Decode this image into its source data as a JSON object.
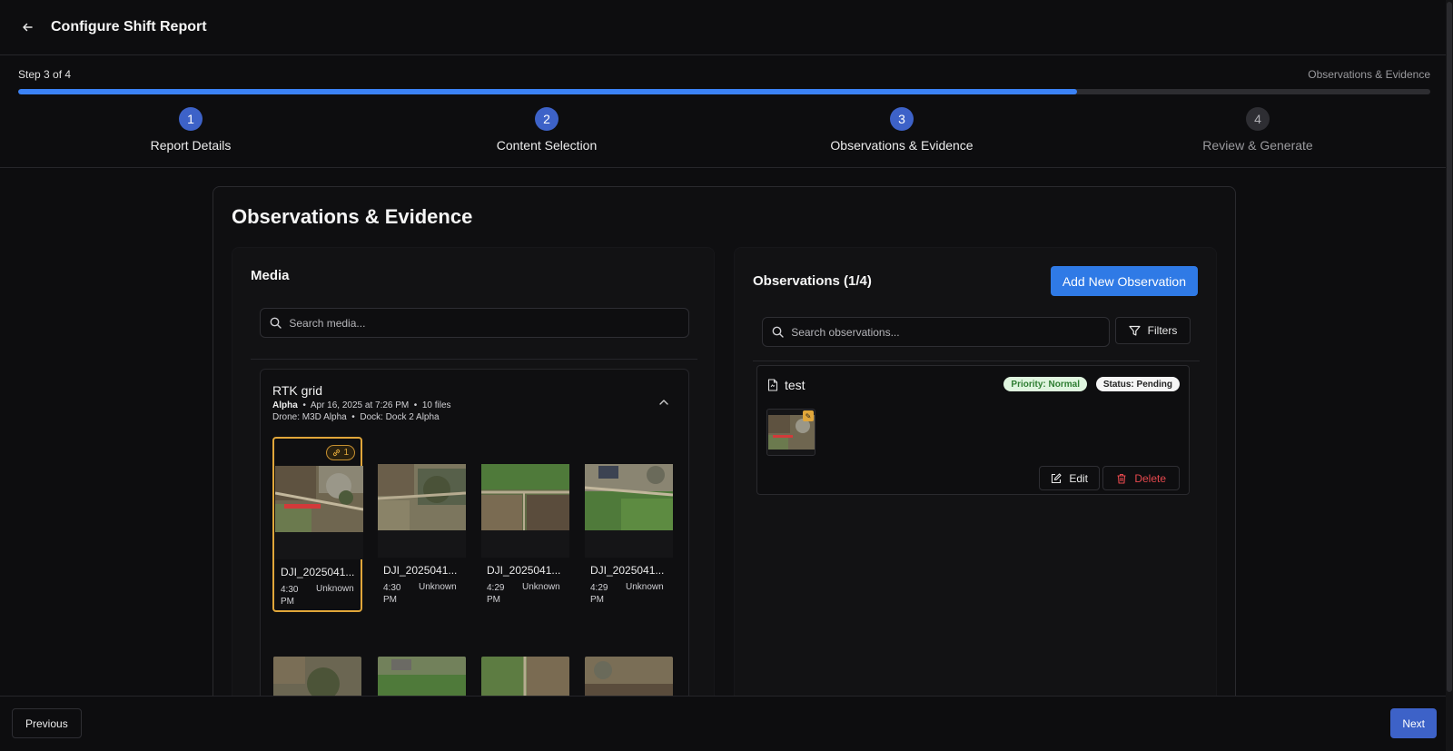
{
  "header": {
    "title": "Configure Shift Report"
  },
  "progress": {
    "step_count": "Step 3 of 4",
    "current_step_name": "Observations & Evidence",
    "fraction": 0.75
  },
  "steps": [
    {
      "number": "1",
      "label": "Report Details",
      "state": "complete"
    },
    {
      "number": "2",
      "label": "Content Selection",
      "state": "complete"
    },
    {
      "number": "3",
      "label": "Observations & Evidence",
      "state": "current"
    },
    {
      "number": "4",
      "label": "Review & Generate",
      "state": "pending"
    }
  ],
  "section": {
    "title": "Observations & Evidence"
  },
  "media": {
    "title": "Media",
    "search_placeholder": "Search media...",
    "group": {
      "name": "RTK grid",
      "team": "Alpha",
      "date": "Apr 16, 2025 at 7:26 PM",
      "files": "10 files",
      "drone": "Drone: M3D Alpha",
      "dock": "Dock: Dock 2 Alpha"
    },
    "items": [
      {
        "name": "DJI_2025041...",
        "time": "4:30 PM",
        "location": "Unknown",
        "selected": true,
        "link_count": "1"
      },
      {
        "name": "DJI_2025041...",
        "time": "4:30 PM",
        "location": "Unknown",
        "selected": false
      },
      {
        "name": "DJI_2025041...",
        "time": "4:29 PM",
        "location": "Unknown",
        "selected": false
      },
      {
        "name": "DJI_2025041...",
        "time": "4:29 PM",
        "location": "Unknown",
        "selected": false
      }
    ]
  },
  "observations": {
    "title": "Observations (1/4)",
    "add_button": "Add New Observation",
    "search_placeholder": "Search observations...",
    "filters_label": "Filters",
    "items": [
      {
        "name": "test",
        "priority": "Priority: Normal",
        "status": "Status: Pending",
        "edit_label": "Edit",
        "delete_label": "Delete"
      }
    ]
  },
  "footer": {
    "previous_label": "Previous",
    "next_label": "Next"
  },
  "colors": {
    "accent": "#3b82f6",
    "selected_border": "#e0a63a",
    "danger": "#e5484d"
  }
}
